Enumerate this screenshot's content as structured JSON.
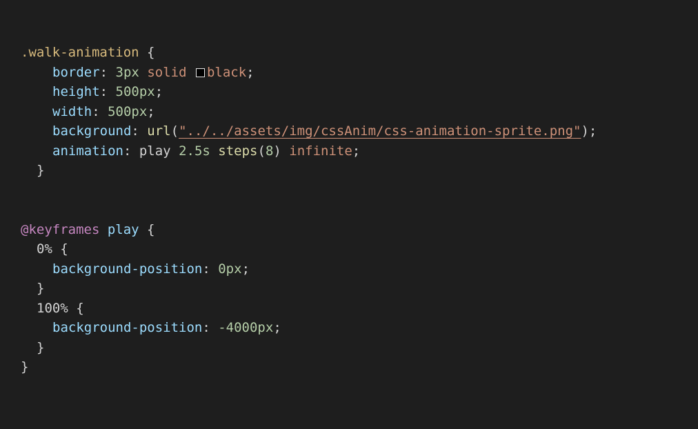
{
  "colors": {
    "background": "#1e1e1e",
    "selector": "#d7ba7d",
    "property": "#9cdcfe",
    "number": "#b5cea8",
    "value": "#ce9178",
    "function": "#dcdcaa",
    "keyword": "#c586c0",
    "punctuation": "#d4d4d4"
  },
  "block1": {
    "selector": ".walk-animation",
    "open": " {",
    "border": {
      "prop": "border",
      "num": "3px",
      "v1": "solid",
      "v2": "black"
    },
    "height": {
      "prop": "height",
      "num": "500px"
    },
    "width": {
      "prop": "width",
      "num": "500px"
    },
    "background": {
      "prop": "background",
      "fn": "url",
      "str": "\"../../assets/img/cssAnim/css-animation-sprite.png\""
    },
    "animation": {
      "prop": "animation",
      "name": "play",
      "dur": "2.5s",
      "fn": "steps",
      "arg": "8",
      "iter": "infinite"
    },
    "close": "}"
  },
  "block2": {
    "at": "@keyframes",
    "name": "play",
    "open": " {",
    "frame1": {
      "sel": "0%",
      "prop": "background-position",
      "num": "0px"
    },
    "frame2": {
      "sel": "100%",
      "prop": "background-position",
      "num": "-4000px"
    },
    "close": "}"
  },
  "icons": {
    "color_swatch": "color-swatch-icon"
  }
}
